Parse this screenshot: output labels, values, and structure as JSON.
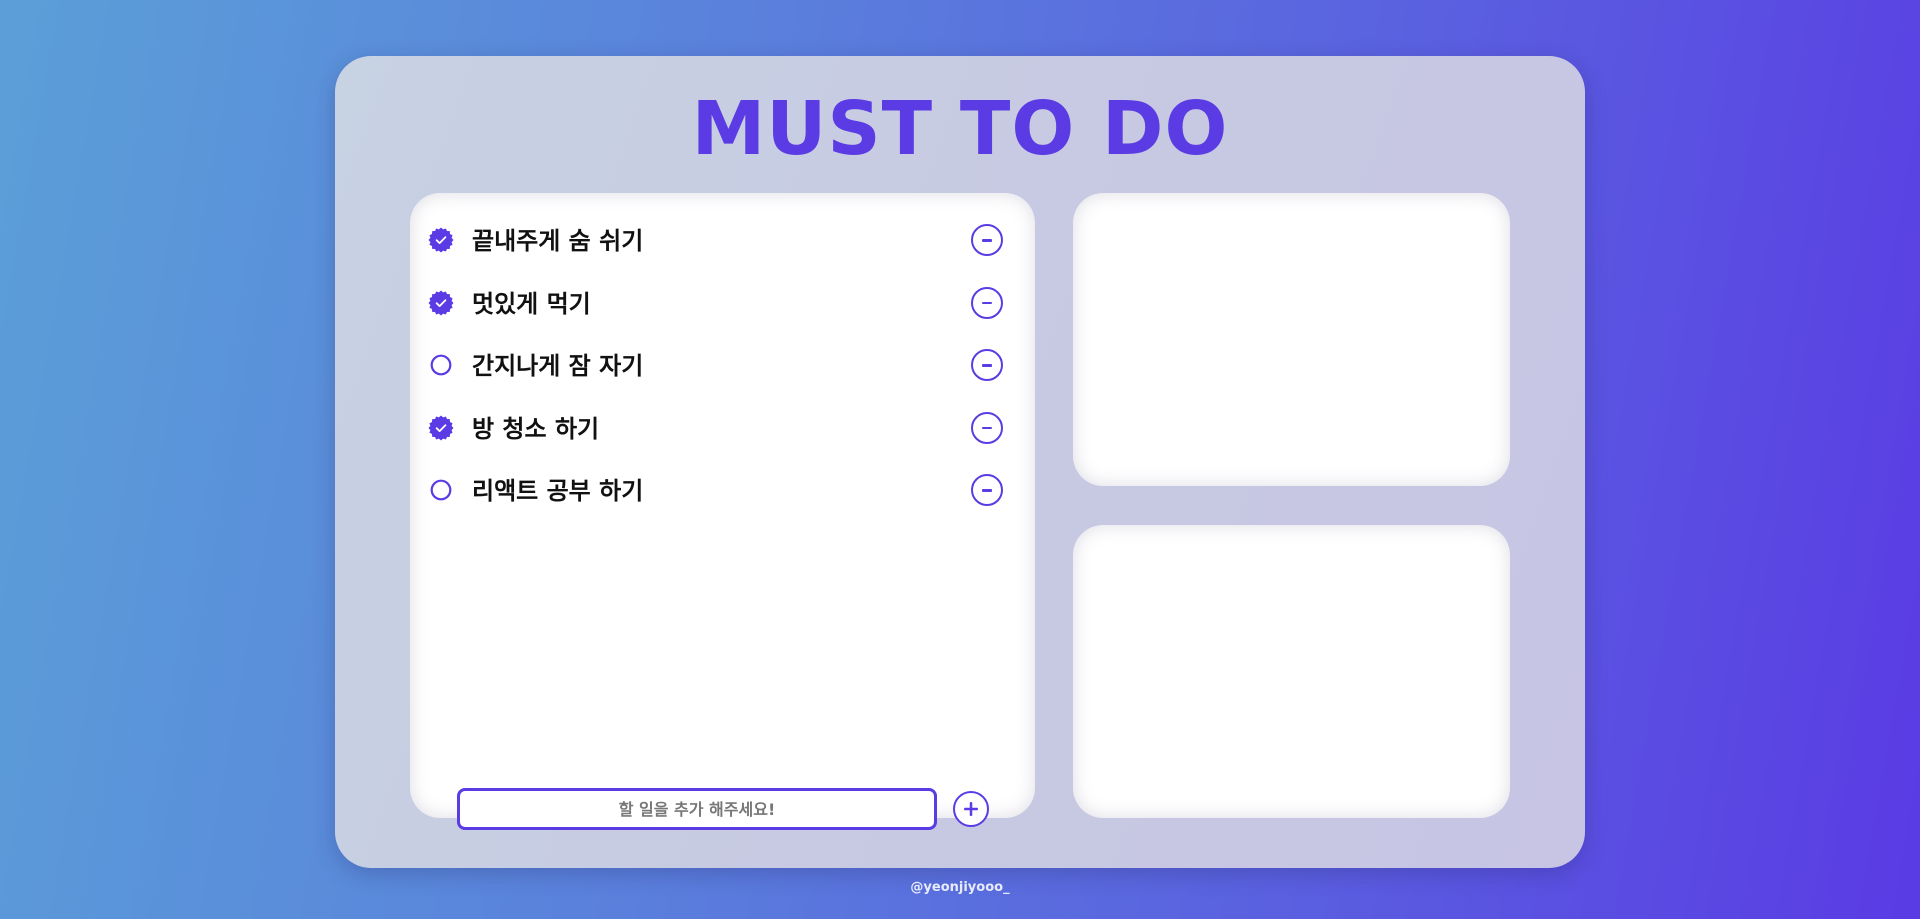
{
  "colors": {
    "accent": "#5a3be4",
    "card_background": "#c7cce3",
    "panel_background": "#ffffff",
    "todo_text": "#111111",
    "placeholder_text": "#777777"
  },
  "app": {
    "title": "MUST TO DO"
  },
  "todos": [
    {
      "text": "끝내주게 숨 쉬기",
      "done": true
    },
    {
      "text": "멋있게 먹기",
      "done": true
    },
    {
      "text": "간지나게 잠 자기",
      "done": false
    },
    {
      "text": "방 청소 하기",
      "done": true
    },
    {
      "text": "리액트 공부 하기",
      "done": false
    }
  ],
  "todo_item": {
    "checked_icon": "badge-check-icon",
    "unchecked_icon": "circle-icon",
    "remove_icon": "minus-circle-icon"
  },
  "add_form": {
    "placeholder": "할 일을 추가 해주세요!",
    "value": "",
    "add_icon": "plus-circle-icon"
  },
  "footer": {
    "credit": "@yeonjiyooo_"
  }
}
